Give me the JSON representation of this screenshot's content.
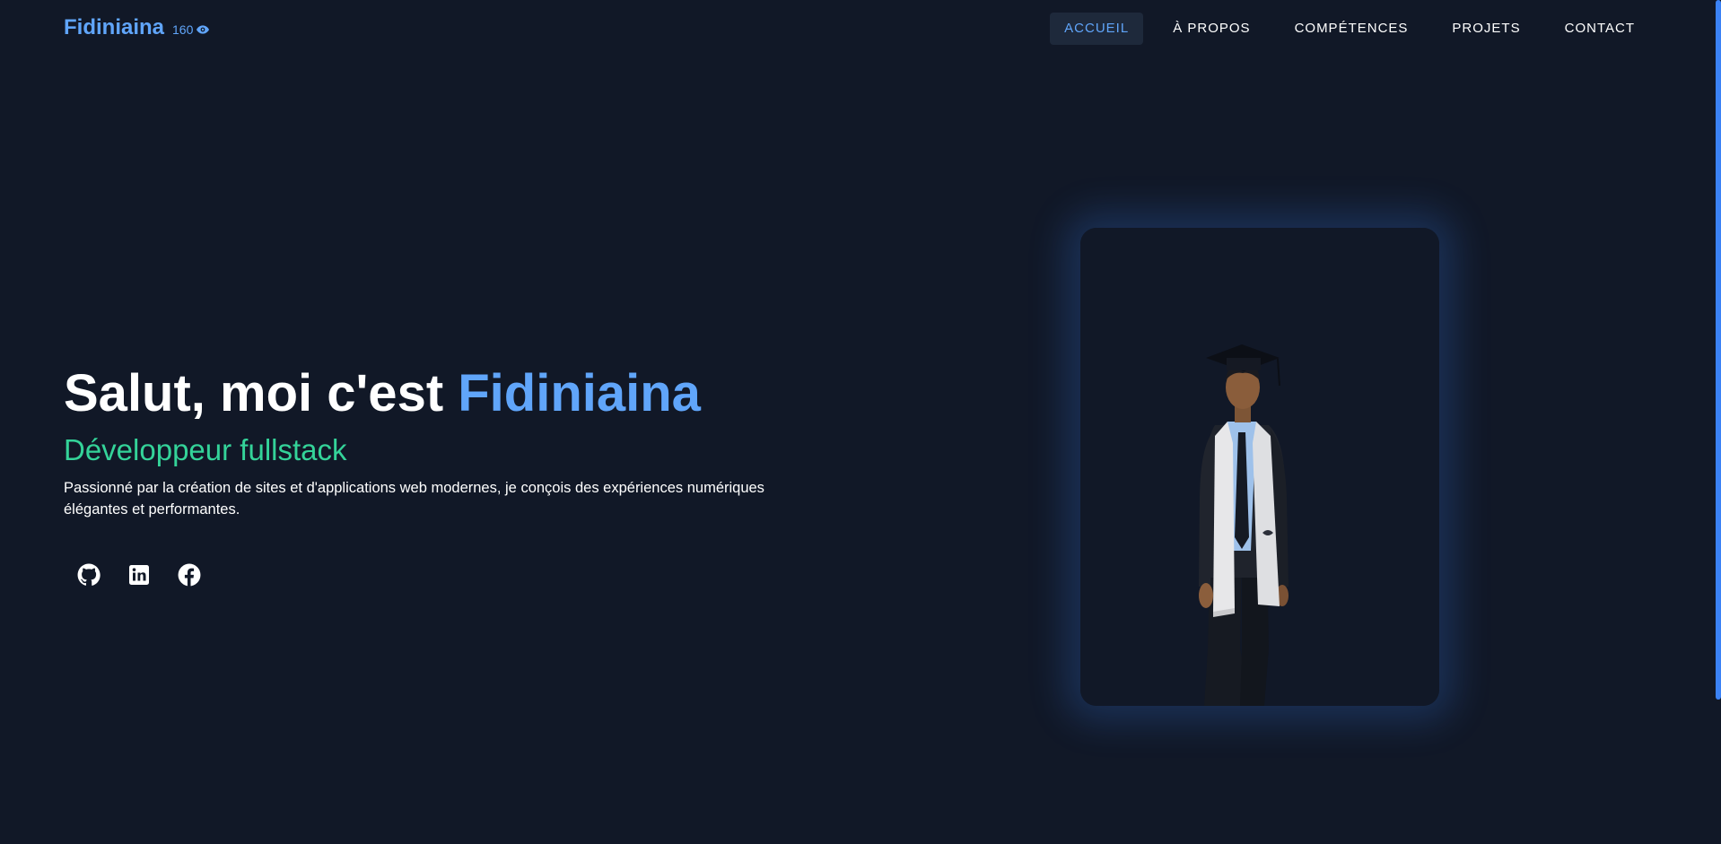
{
  "header": {
    "brand": "Fidiniaina",
    "view_count": "160",
    "nav": [
      {
        "label": "ACCUEIL",
        "active": true
      },
      {
        "label": "À PROPOS",
        "active": false
      },
      {
        "label": "COMPÉTENCES",
        "active": false
      },
      {
        "label": "PROJETS",
        "active": false
      },
      {
        "label": "CONTACT",
        "active": false
      }
    ]
  },
  "hero": {
    "title_prefix": "Salut, moi c'est ",
    "title_name": "Fidiniaina",
    "subtitle": "Développeur fullstack",
    "description": "Passionné par la création de sites et d'applications web modernes, je conçois des expériences numériques élégantes et performantes."
  },
  "socials": [
    {
      "icon": "github-icon"
    },
    {
      "icon": "linkedin-icon"
    },
    {
      "icon": "facebook-icon"
    }
  ],
  "photo": {
    "subject": "graduation-portrait"
  },
  "colors": {
    "background": "#111827",
    "accent": "#60a5fa",
    "subtitle": "#34d399",
    "text": "#ffffff",
    "nav_active_bg": "#1e293b"
  }
}
